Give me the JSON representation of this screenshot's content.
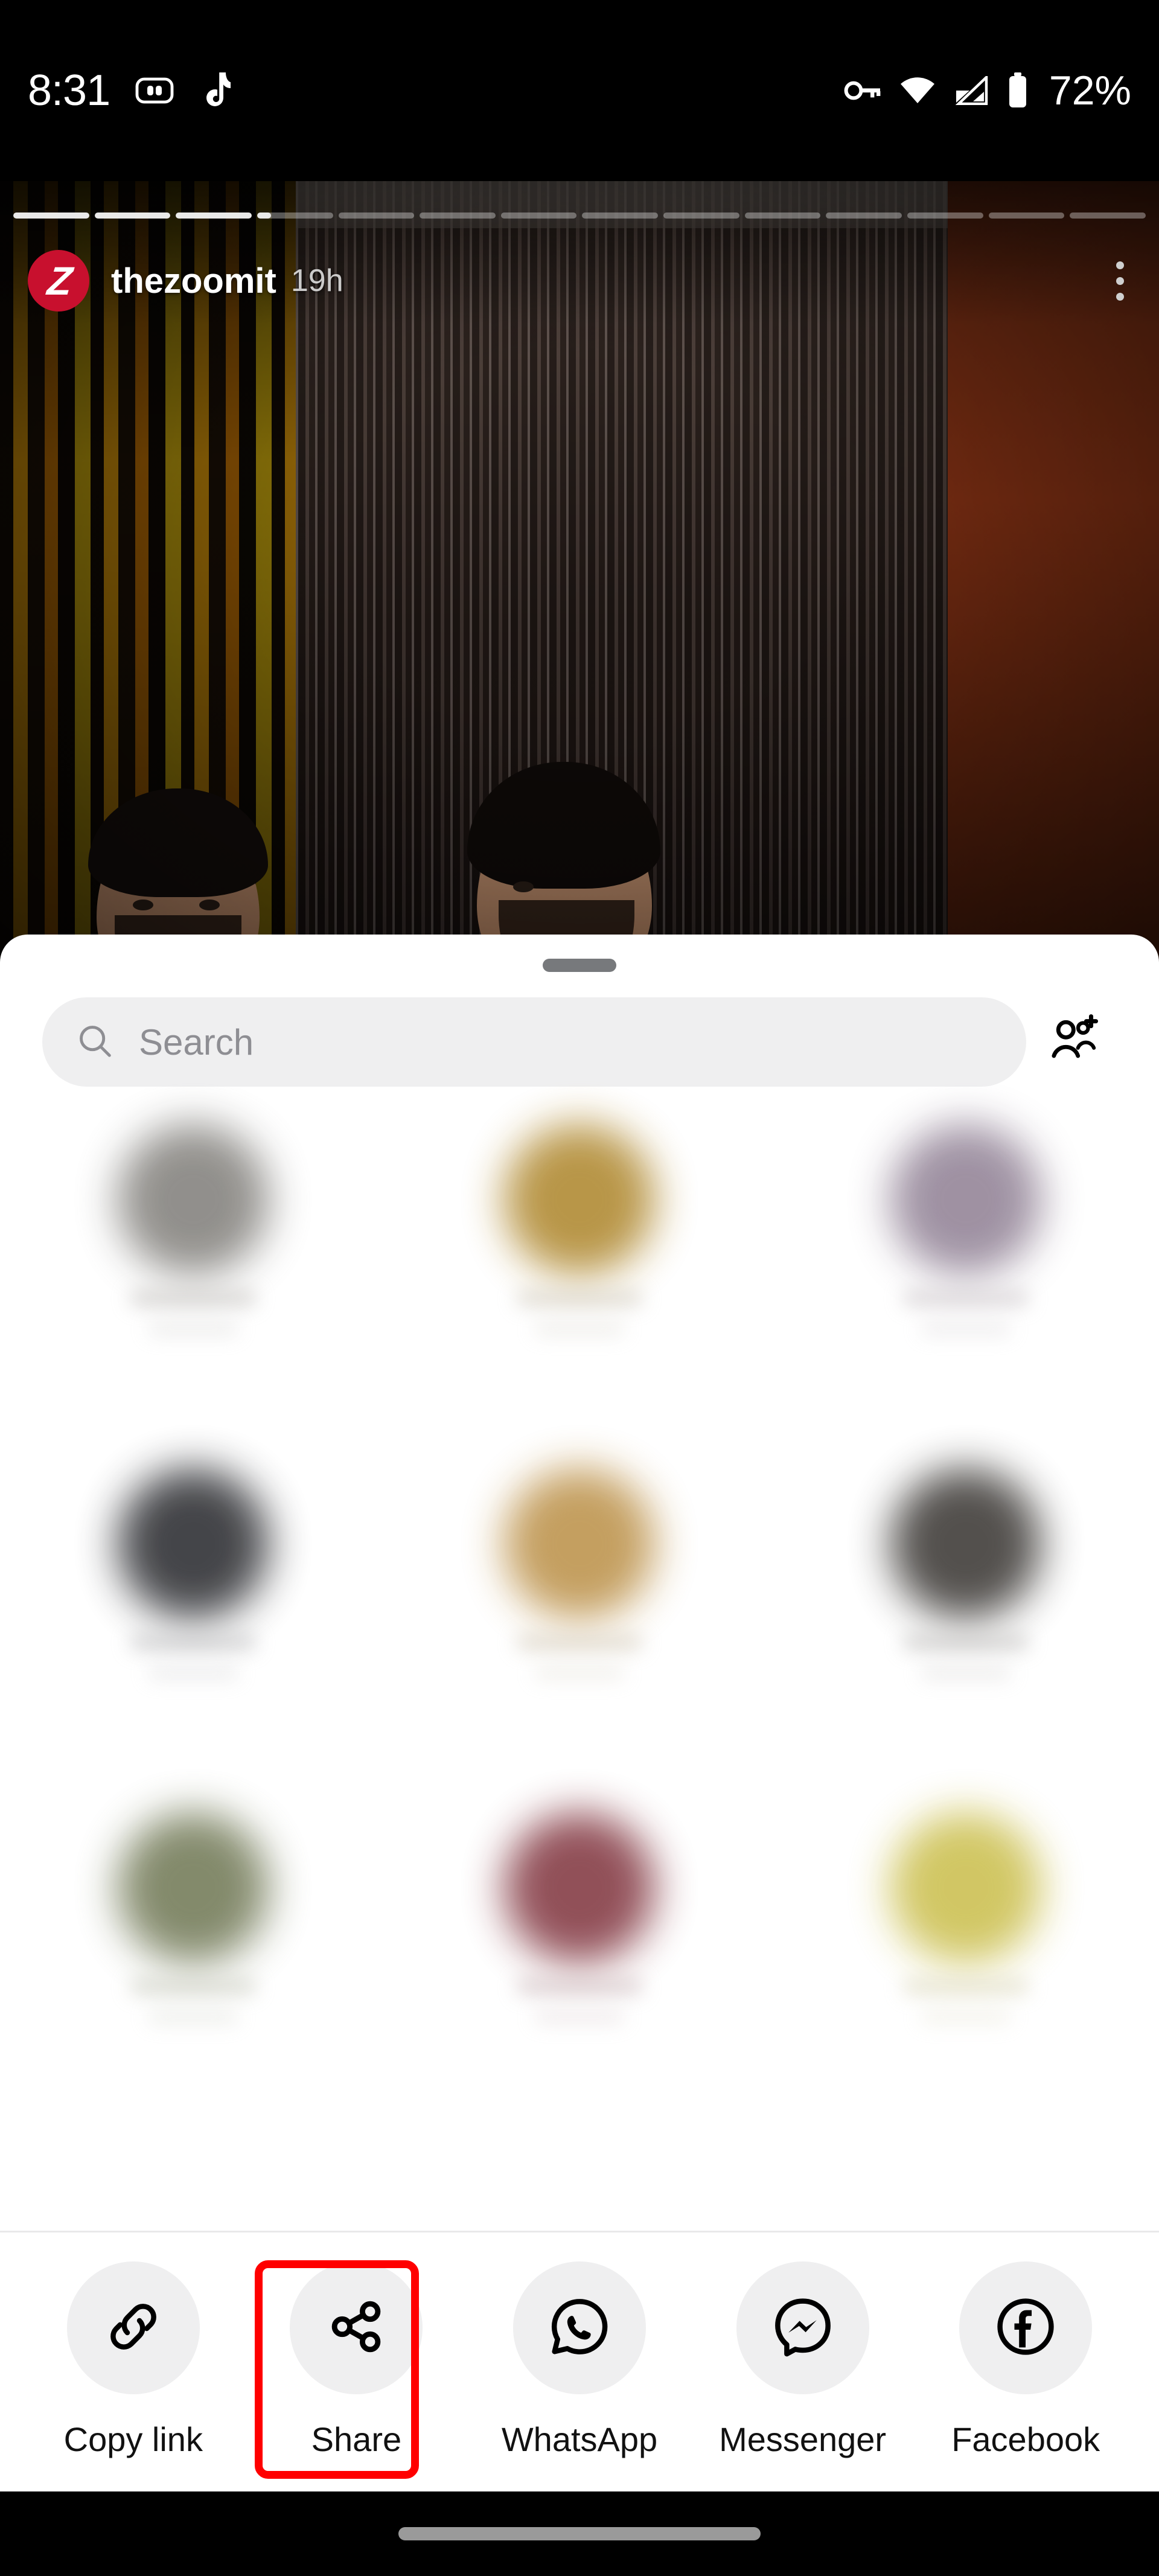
{
  "status_bar": {
    "time": "8:31",
    "battery_percent": "72%",
    "icons": [
      "wallet-card-icon",
      "tiktok-music-note-icon",
      "vpn-key-icon",
      "wifi-icon",
      "cellular-signal-icon",
      "battery-icon"
    ]
  },
  "story": {
    "username": "thezoomit",
    "timestamp": "19h",
    "avatar_letter": "Z",
    "avatar_color": "#c8102e",
    "menu_icon": "three-dot-menu-icon",
    "progress": {
      "total_segments": 14,
      "completed_segments": 3,
      "current_segment_percent": 18
    }
  },
  "share_sheet": {
    "grabber": "drag-handle",
    "search": {
      "placeholder": "Search",
      "value": "",
      "icon": "search-icon"
    },
    "add_people_icon": "add-people-icon",
    "contacts": [
      {
        "avatar_color": "#8c8a86",
        "name_color": "#b9b6b2"
      },
      {
        "avatar_color": "#b5913f",
        "name_color": "#c9c2b3"
      },
      {
        "avatar_color": "#9a8c9e",
        "name_color": "#c3bcc0"
      },
      {
        "avatar_color": "#3b3c40",
        "name_color": "#b4b4b6"
      },
      {
        "avatar_color": "#c19a58",
        "name_color": "#cdc3b0"
      },
      {
        "avatar_color": "#4a4744",
        "name_color": "#b6b4b2"
      },
      {
        "avatar_color": "#7d8464",
        "name_color": "#c0c3b4"
      },
      {
        "avatar_color": "#8c4750",
        "name_color": "#c6b2b5"
      },
      {
        "avatar_color": "#cfc45c",
        "name_color": "#d6d2b3"
      }
    ],
    "actions": [
      {
        "label": "Copy link",
        "icon": "link-icon",
        "highlighted": false
      },
      {
        "label": "Share",
        "icon": "share-nodes-icon",
        "highlighted": true
      },
      {
        "label": "WhatsApp",
        "icon": "whatsapp-icon",
        "highlighted": false
      },
      {
        "label": "Messenger",
        "icon": "messenger-icon",
        "highlighted": false
      },
      {
        "label": "Facebook",
        "icon": "facebook-icon",
        "highlighted": false
      }
    ],
    "highlight_color": "#ff0000"
  },
  "nav_bar": {
    "gesture_pill": "home-gesture-pill"
  }
}
